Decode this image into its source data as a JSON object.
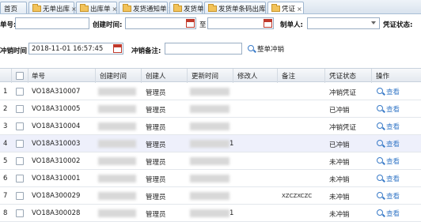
{
  "tabs": [
    {
      "label": "首页",
      "active": false,
      "folder": false,
      "close": false
    },
    {
      "label": "无单出库",
      "active": false,
      "folder": true,
      "close": true
    },
    {
      "label": "出库单",
      "active": false,
      "folder": true,
      "close": true
    },
    {
      "label": "发货通知单",
      "active": false,
      "folder": true,
      "close": true
    },
    {
      "label": "发货单",
      "active": false,
      "folder": true,
      "close": true
    },
    {
      "label": "发货单条码出库",
      "active": false,
      "folder": true,
      "close": true
    },
    {
      "label": "凭证",
      "active": true,
      "folder": true,
      "close": true
    }
  ],
  "filters": {
    "doc_no_label": "单号:",
    "create_time_label": "创建时间:",
    "to_label": "至",
    "maker_label": "制单人:",
    "voucher_status_label": "凭证状态:",
    "writeoff_time_label": "冲销时间",
    "writeoff_time_value": "2018-11-01 16:57:45",
    "writeoff_note_label": "冲销备注:",
    "whole_writeoff_label": "整单冲销"
  },
  "table": {
    "headers": {
      "number": "",
      "check": "",
      "doc_no": "单号",
      "create_time": "创建时间",
      "creator": "创建人",
      "update_time": "更新时间",
      "modifier": "修改人",
      "remark": "备注",
      "status": "凭证状态",
      "action": "操作"
    },
    "rows": [
      {
        "n": "1",
        "doc_no": "VO18A310007",
        "creator": "管理员",
        "remark": "",
        "status": "冲销凭证",
        "action": "查看",
        "extra": "",
        "selected": false
      },
      {
        "n": "2",
        "doc_no": "VO18A310005",
        "creator": "管理员",
        "remark": "",
        "status": "已冲销",
        "action": "查看",
        "extra": "",
        "selected": false
      },
      {
        "n": "3",
        "doc_no": "VO18A310004",
        "creator": "管理员",
        "remark": "",
        "status": "冲销凭证",
        "action": "查看",
        "extra": "",
        "selected": false
      },
      {
        "n": "4",
        "doc_no": "VO18A310003",
        "creator": "管理员",
        "remark": "",
        "status": "已冲销",
        "action": "查看",
        "extra": "1",
        "selected": true
      },
      {
        "n": "5",
        "doc_no": "VO18A310002",
        "creator": "管理员",
        "remark": "",
        "status": "未冲销",
        "action": "查看",
        "extra": "",
        "selected": false
      },
      {
        "n": "6",
        "doc_no": "VO18A310001",
        "creator": "管理员",
        "remark": "",
        "status": "未冲销",
        "action": "查看",
        "extra": "",
        "selected": false
      },
      {
        "n": "7",
        "doc_no": "VO18A300029",
        "creator": "管理员",
        "remark": "XZCZXCZC",
        "status": "未冲销",
        "action": "查看",
        "extra": "",
        "selected": false
      },
      {
        "n": "8",
        "doc_no": "VO18A300028",
        "creator": "管理员",
        "remark": "",
        "status": "未冲销",
        "action": "查看",
        "extra": "1",
        "selected": false
      }
    ]
  },
  "colors": {
    "accent": "#3a7bc8",
    "selected_row": "#eef0fb"
  }
}
